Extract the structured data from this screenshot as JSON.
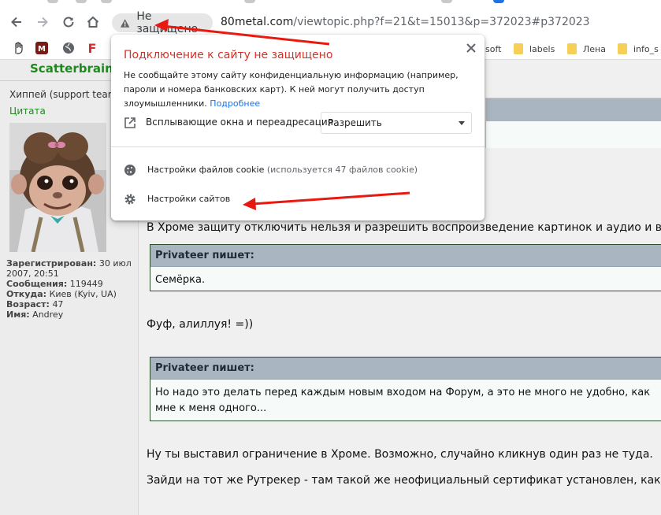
{
  "browser": {
    "security_label": "Не защищено",
    "url_host": "80metal.com",
    "url_rest": "/viewtopic.php?f=21&t=15013&p=372023#p372023"
  },
  "bookmarks": {
    "folders": [
      {
        "label": "soft"
      },
      {
        "label": "labels"
      },
      {
        "label": "Лена"
      },
      {
        "label": "info_s"
      }
    ],
    "f_glyph": "F"
  },
  "popup": {
    "title": "Подключение к сайту не защищено",
    "desc": "Не сообщайте этому сайту конфиденциальную информацию (например, пароли и номера банковских карт). К ней могут получить доступ злоумышленники.",
    "more_link": "Подробнее",
    "perm_label": "Всплывающие окна и переадресация",
    "perm_value": "Разрешить",
    "cookie_label": "Настройки файлов cookie",
    "cookie_note": "(используется 47 файлов cookie)",
    "site_settings": "Настройки сайтов"
  },
  "profile": {
    "username": "Scatterbrain",
    "rank": "Хиппей (support team)",
    "quote_link": "Цитата",
    "registered_label": "Зарегистрирован:",
    "registered_value": "30 июл 2007, 20:51",
    "messages_label": "Сообщения:",
    "messages_value": "119449",
    "from_label": "Откуда:",
    "from_value": "Киев (Kyiv, UA)",
    "age_label": "Возраст:",
    "age_value": "47",
    "name_label": "Имя:",
    "name_value": "Andrey"
  },
  "post": {
    "line1": "В Хроме защиту отключить нельзя и разрешить воспроизведение картинок и аудио и в",
    "quote1_author": "Privateer пишет:",
    "quote1_text": "Семёрка.",
    "line2": "Фуф, алиллуя! =))",
    "quote2_author": "Privateer пишет:",
    "quote2_text": "Но надо это делать перед каждым новым входом на Форум, а это не много не удобно, как мне к меня одного...",
    "line3": "Ну ты выставил ограничение в Хроме. Возможно, случайно кликнув один раз не туда.",
    "line4": "Зайди на тот же Рутрекер - там такой же неофициальный сертификат установлен, как"
  },
  "colors": {
    "warning_red": "#d93025",
    "link_blue": "#1a73e8",
    "forum_green": "#1e8a1e",
    "quote_header": "#a9b6c2",
    "arrow_red": "#e8190f"
  }
}
